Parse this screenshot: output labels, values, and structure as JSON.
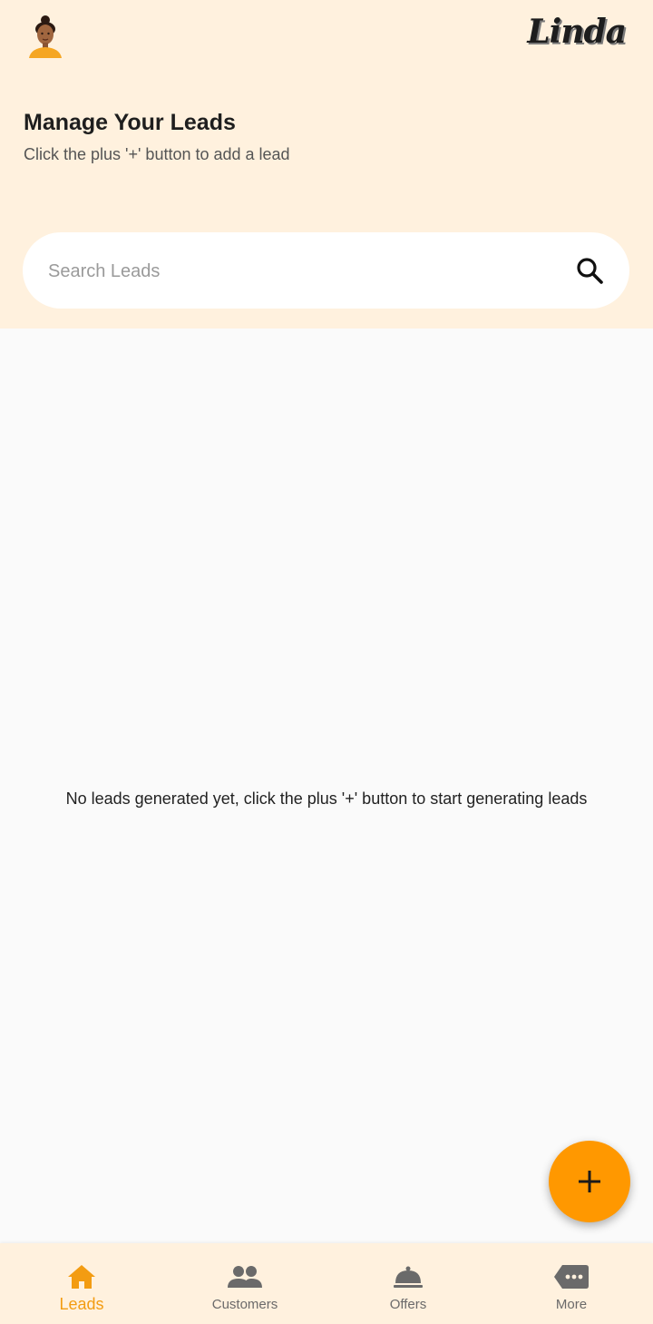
{
  "app": {
    "brand": "Linda"
  },
  "header": {
    "title": "Manage Your Leads",
    "subtitle": "Click the plus '+' button to add a lead"
  },
  "search": {
    "placeholder": "Search Leads",
    "value": "",
    "icon": "search-icon"
  },
  "main": {
    "empty_message": "No leads generated yet, click the plus '+' button to start generating leads"
  },
  "fab": {
    "icon": "plus-icon"
  },
  "bottom_nav": {
    "items": [
      {
        "label": "Leads",
        "icon": "home-icon",
        "active": true
      },
      {
        "label": "Customers",
        "icon": "people-icon",
        "active": false
      },
      {
        "label": "Offers",
        "icon": "cloche-icon",
        "active": false
      },
      {
        "label": "More",
        "icon": "more-tag-icon",
        "active": false
      }
    ]
  },
  "colors": {
    "header_bg": "#fff1de",
    "accent": "#ff9800",
    "active_label": "#f39c12",
    "inactive": "#6a6a6a"
  }
}
